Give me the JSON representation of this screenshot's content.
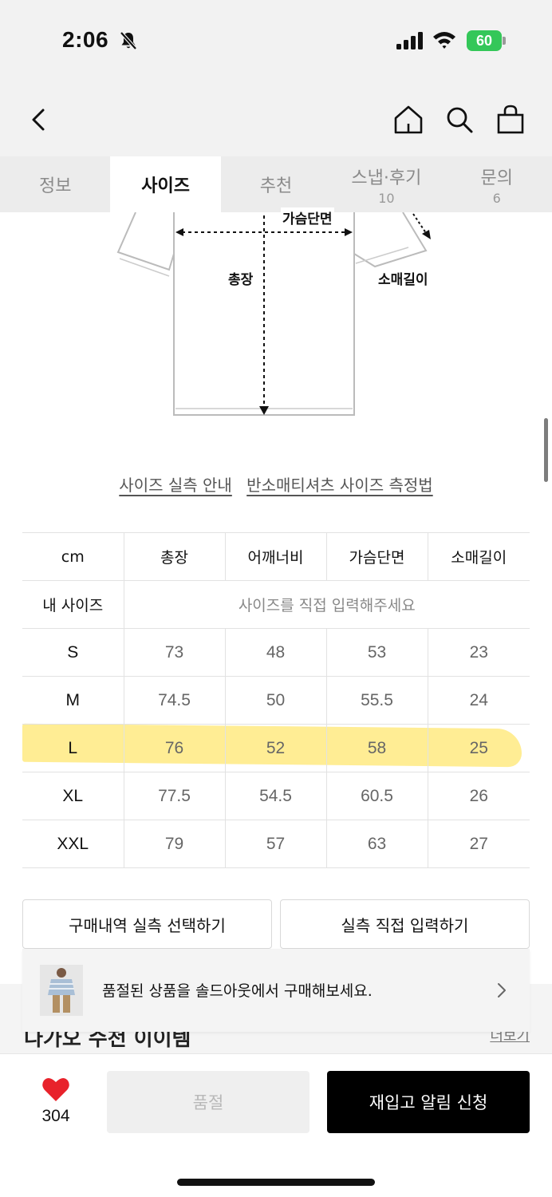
{
  "status_bar": {
    "time": "2:06",
    "battery": "60",
    "battery_color": "#34c759"
  },
  "nav": {
    "back_icon": "chevron-left-icon",
    "home_icon": "home-icon",
    "search_icon": "search-icon",
    "cart_icon": "shopping-bag-icon"
  },
  "tabs": [
    {
      "label": "정보",
      "count": ""
    },
    {
      "label": "사이즈",
      "count": ""
    },
    {
      "label": "추천",
      "count": ""
    },
    {
      "label": "스냅·후기",
      "count": "10"
    },
    {
      "label": "문의",
      "count": "6"
    }
  ],
  "diagram": {
    "chest_label": "가슴단면",
    "length_label": "총장",
    "sleeve_label": "소매길이"
  },
  "links": {
    "size_guide": "사이즈 실측 안내",
    "measure_method": "반소매티셔츠 사이즈 측정법"
  },
  "size_table": {
    "headers": [
      "cm",
      "총장",
      "어깨너비",
      "가슴단면",
      "소매길이"
    ],
    "my_size_label": "내 사이즈",
    "my_size_placeholder": "사이즈를 직접 입력해주세요",
    "rows": [
      {
        "size": "S",
        "values": [
          "73",
          "48",
          "53",
          "23"
        ]
      },
      {
        "size": "M",
        "values": [
          "74.5",
          "50",
          "55.5",
          "24"
        ]
      },
      {
        "size": "L",
        "values": [
          "76",
          "52",
          "58",
          "25"
        ]
      },
      {
        "size": "XL",
        "values": [
          "77.5",
          "54.5",
          "60.5",
          "26"
        ]
      },
      {
        "size": "XXL",
        "values": [
          "79",
          "57",
          "63",
          "27"
        ]
      }
    ],
    "highlight_color": "#ffde3c"
  },
  "actions": {
    "select_history": "구매내역 실측 선택하기",
    "direct_input": "실측 직접 입력하기"
  },
  "banner": {
    "text": "품절된 상품을 솔드아웃에서 구매해보세요."
  },
  "section": {
    "title": "다가오 수천 이이템",
    "more": "더보기"
  },
  "bottom_bar": {
    "like_count": "304",
    "heart_color": "#e8222b",
    "soldout_label": "품절",
    "restock_label": "재입고 알림 신청"
  }
}
